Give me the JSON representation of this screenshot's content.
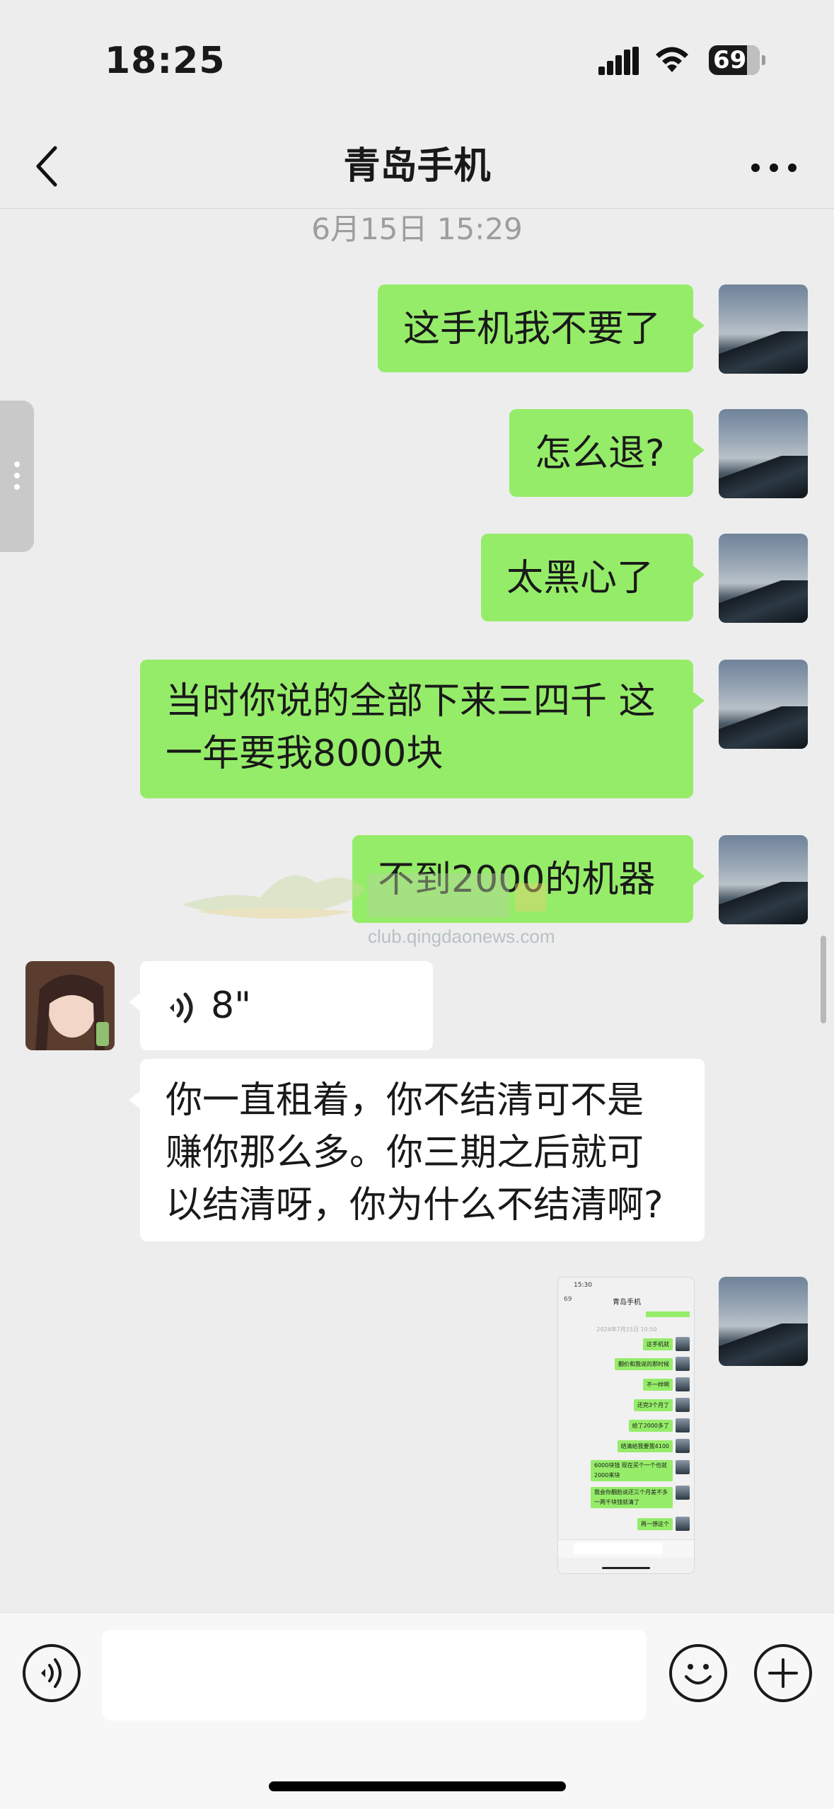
{
  "status_bar": {
    "time": "18:25",
    "battery": "69",
    "icons": [
      "cellular-signal-icon",
      "wifi-icon",
      "battery-icon"
    ]
  },
  "nav": {
    "title": "青岛手机",
    "back_icon": "chevron-left-icon",
    "more_icon": "ellipsis-icon"
  },
  "chat": {
    "timestamp": "6月15日 15:29",
    "messages": [
      {
        "from": "self",
        "type": "text",
        "text": "这手机我不要了"
      },
      {
        "from": "self",
        "type": "text",
        "text": "怎么退?"
      },
      {
        "from": "self",
        "type": "text",
        "text": "太黑心了"
      },
      {
        "from": "self",
        "type": "text",
        "line1": "当时你说的全部下来三四千 这",
        "line2": "一年要我8000块"
      },
      {
        "from": "self",
        "type": "text",
        "text": "不到2000的机器"
      },
      {
        "from": "other",
        "type": "voice",
        "duration": "8\""
      },
      {
        "from": "other",
        "type": "text",
        "line1": "你一直租着，你不结清可不是",
        "line2": "赚你那么多。你三期之后就可",
        "line3": "以结清呀，你为什么不结清啊?"
      },
      {
        "from": "self",
        "type": "image"
      }
    ]
  },
  "screenshot_thumbnail": {
    "time": "15:30",
    "badge": "69",
    "title": "青岛手机",
    "date": "2024年7月15日 10:50",
    "messages": [
      "这手机就",
      "翻价和我说的那时候",
      "不一样啊",
      "还完3个月了",
      "给了2000多了",
      "结清给我要我4100",
      "6000块钱 现在买个一个也就2000来块",
      "我会你翻脸说还三个月差不多一两千块钱就清了",
      "再一想这个"
    ]
  },
  "watermark": {
    "text": "club.qingdaonews.com"
  },
  "input_bar": {
    "voice_icon": "voice-input-icon",
    "emoji_icon": "emoji-icon",
    "plus_icon": "plus-icon",
    "value": ""
  },
  "colors": {
    "outgoing_bubble": "#95ec69",
    "incoming_bubble": "#ffffff",
    "background": "#ededed"
  }
}
